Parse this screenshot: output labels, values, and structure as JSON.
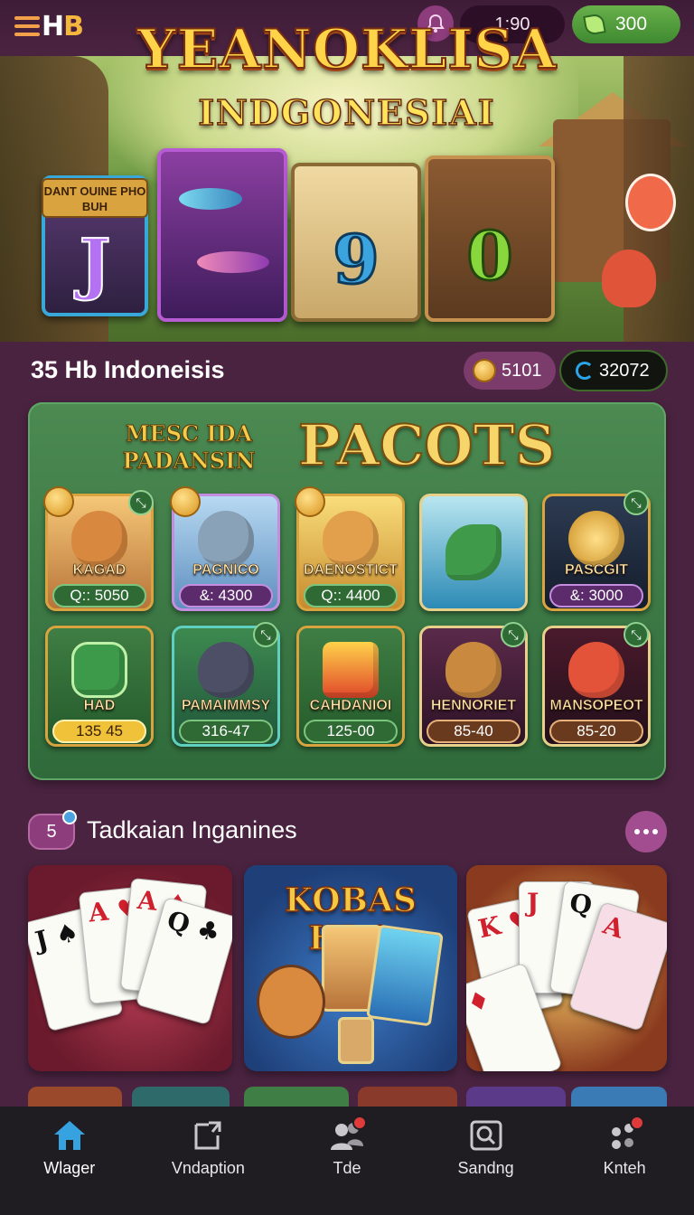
{
  "header": {
    "logo_text": "HB",
    "logo_prefix": "≡",
    "timer": "1:90",
    "coins": "300",
    "icons": [
      "menu-icon",
      "bell-icon",
      "leaf-icon"
    ]
  },
  "hero": {
    "title": "YEANOKLISA",
    "subtitle": "INDGONESIAI",
    "reel_label": "DANT OUINE PHO BUH",
    "reels": [
      "J",
      "",
      "9",
      "0"
    ]
  },
  "section1": {
    "title": "35 Hb Indoneisis",
    "stat_coins": "5101",
    "stat_spins": "32072"
  },
  "panel": {
    "subtitle": "MESC IDA PADANSIN",
    "title": "PACOTS",
    "games": [
      {
        "name": "KAGAD",
        "value": "Q:: 5050"
      },
      {
        "name": "PAGNICO",
        "value": "&: 4300"
      },
      {
        "name": "DAENOSTICT",
        "value": "Q:: 4400"
      },
      {
        "name": "",
        "value": ""
      },
      {
        "name": "PASCGIT",
        "value": "&: 3000"
      },
      {
        "name": "HAD",
        "value": "135 45"
      },
      {
        "name": "PAMAIMMSY",
        "value": "316-47"
      },
      {
        "name": "CAHDANIOI",
        "value": "125-00"
      },
      {
        "name": "HENNORIET",
        "value": "85-40"
      },
      {
        "name": "MANSOPEOT",
        "value": "85-20"
      }
    ]
  },
  "section2": {
    "badge": "5",
    "title": "Tadkaian Inganines",
    "featured_title": "KOBAS HDA"
  },
  "nav": {
    "items": [
      {
        "label": "Wlager",
        "icon": "home-icon"
      },
      {
        "label": "Vndaption",
        "icon": "document-icon"
      },
      {
        "label": "Tde",
        "icon": "people-icon"
      },
      {
        "label": "Sandng",
        "icon": "search-icon"
      },
      {
        "label": "Knteh",
        "icon": "games-icon"
      }
    ]
  },
  "colors": {
    "background": "#4a2340",
    "panel_green": "#3d7a46",
    "accent_gold": "#f4b63c",
    "nav_bg": "#1f1d22",
    "active_nav": "#36a3e0"
  }
}
